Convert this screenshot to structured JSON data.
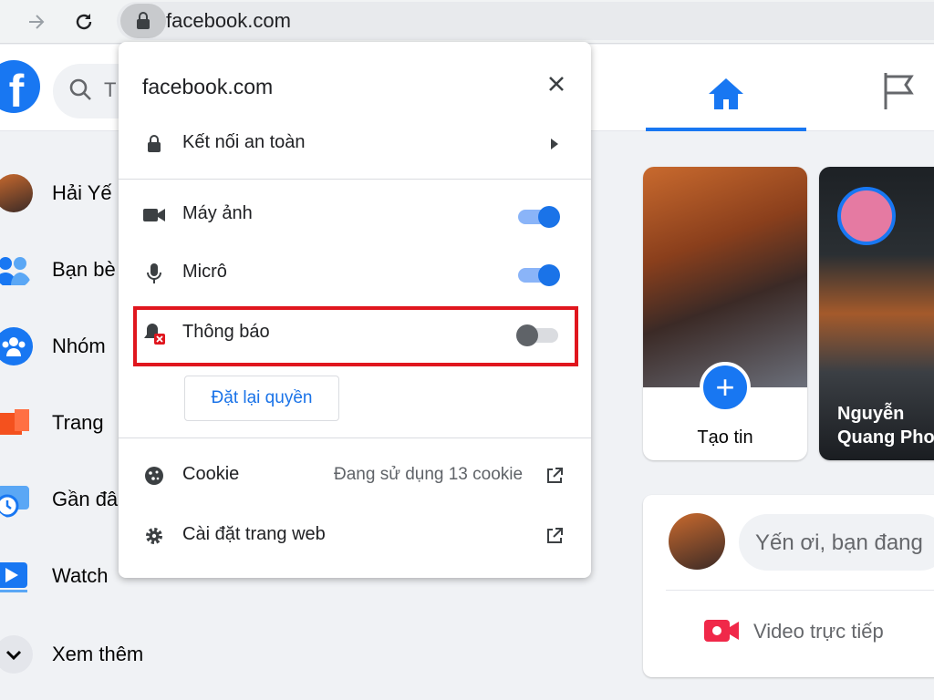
{
  "browser": {
    "url": "facebook.com"
  },
  "facebook": {
    "logo_letter": "f",
    "search_placeholder": "T",
    "sidebar": [
      {
        "label": "Hải Yế",
        "icon": "profile-avatar"
      },
      {
        "label": "Bạn bè",
        "icon": "friends-icon"
      },
      {
        "label": "Nhóm",
        "icon": "groups-icon"
      },
      {
        "label": "Trang",
        "icon": "pages-flag-icon"
      },
      {
        "label": "Gần đâ",
        "icon": "memories-clock-icon"
      },
      {
        "label": "Watch",
        "icon": "watch-video-icon"
      },
      {
        "label": "Xem thêm",
        "icon": "chevron-down-icon"
      }
    ],
    "stories": {
      "create_label": "Tạo tin",
      "plus": "+",
      "friend_name": "Nguyễn Quang Pho"
    },
    "composer": {
      "placeholder": "Yến ơi, bạn đang",
      "live_label": "Video trực tiếp"
    },
    "colors": {
      "brand": "#1877f2",
      "live_red": "#f02849"
    }
  },
  "site_info": {
    "domain": "facebook.com",
    "connection_label": "Kết nối an toàn",
    "permissions": [
      {
        "label": "Máy ảnh",
        "icon": "camera-icon",
        "enabled": true
      },
      {
        "label": "Micrô",
        "icon": "microphone-icon",
        "enabled": true
      },
      {
        "label": "Thông báo",
        "icon": "notifications-blocked-icon",
        "enabled": false
      }
    ],
    "reset_label": "Đặt lại quyền",
    "cookie_label": "Cookie",
    "cookie_status": "Đang sử dụng 13 cookie",
    "site_settings_label": "Cài đặt trang web",
    "colors": {
      "highlight": "#e0161e",
      "toggle_on": "#1a73e8"
    }
  }
}
